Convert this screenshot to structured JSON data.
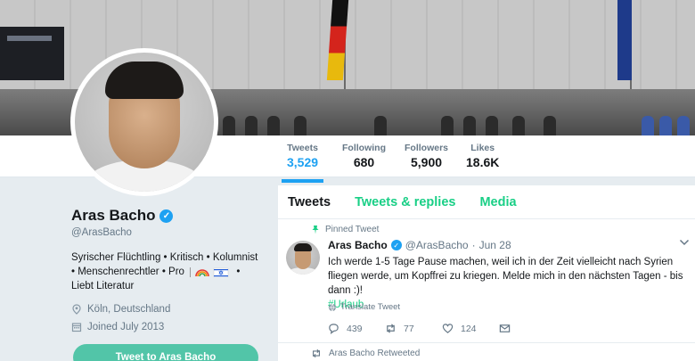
{
  "nav": {
    "stats": [
      {
        "label": "Tweets",
        "value": "3,529"
      },
      {
        "label": "Following",
        "value": "680"
      },
      {
        "label": "Followers",
        "value": "5,900"
      },
      {
        "label": "Likes",
        "value": "18.6K"
      }
    ]
  },
  "profile": {
    "name": "Aras Bacho",
    "handle": "@ArasBacho",
    "bio_line1": "Syrischer Flüchtling • Kritisch • Kolumnist",
    "bio_line2": "• Menschenrechtler • Pro",
    "bio_line3": "Liebt Literatur",
    "location": "Köln, Deutschland",
    "joined": "Joined July 2013",
    "tweet_to_button": "Tweet to Aras Bacho"
  },
  "timeline": {
    "tabs": [
      "Tweets",
      "Tweets & replies",
      "Media"
    ],
    "pinned_label": "Pinned Tweet",
    "tweet": {
      "author": "Aras Bacho",
      "handle": "@ArasBacho",
      "sep": "·",
      "date": "Jun 28",
      "text": "Ich werde 1-5 Tage Pause machen, weil ich in der Zeit vielleicht nach Syrien fliegen werde, um Kopffrei zu kriegen. Melde mich in den nächsten Tagen - bis dann :)!",
      "hashtag": "#Urlaub",
      "translate": "Translate Tweet",
      "replies": "439",
      "retweets": "77",
      "likes": "124"
    },
    "retweeted_label": "Aras Bacho Retweeted"
  },
  "colors": {
    "accent": "#1da1f2",
    "green": "#19cf86",
    "button": "#52c5a8"
  }
}
